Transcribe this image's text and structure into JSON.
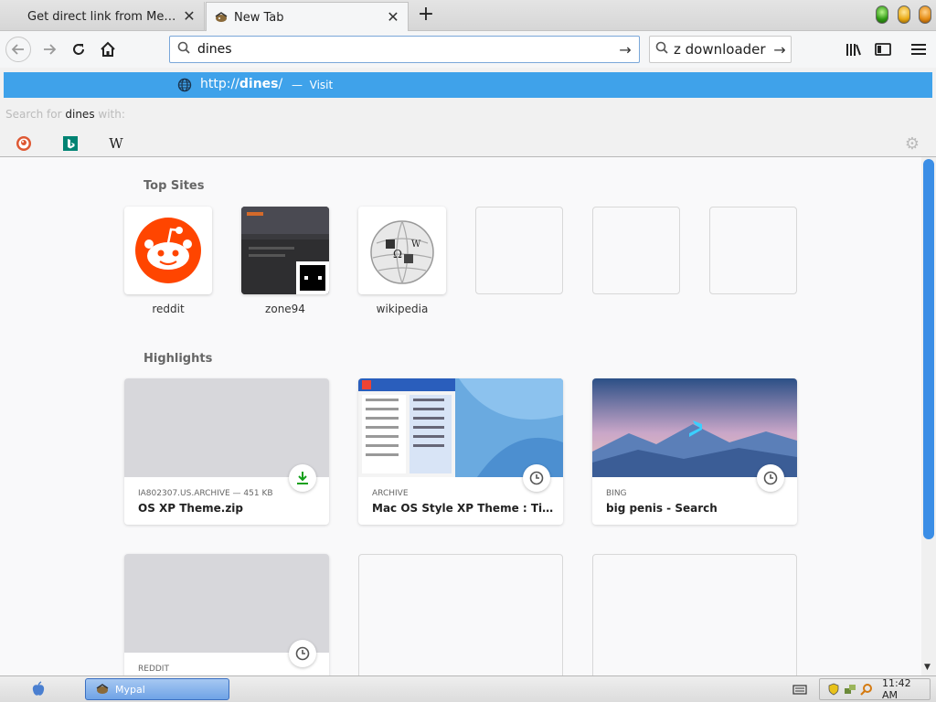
{
  "tabs": [
    {
      "title": "Get direct link from Mega.N…",
      "active": false
    },
    {
      "title": "New Tab",
      "active": true
    }
  ],
  "toolbar": {
    "url_value": "dines",
    "search_value": "z downloader"
  },
  "dropdown": {
    "suggestion": {
      "prefix": "http://",
      "domain": "dines",
      "suffix": "/",
      "separator": "—",
      "action": "Visit"
    },
    "search_for_prefix": "Search for",
    "search_term": "dines",
    "search_for_suffix": "with:",
    "engines": [
      "duckduckgo-icon",
      "bing-icon",
      "wikipedia-icon"
    ],
    "wiki_glyph": "W"
  },
  "newtab": {
    "top_sites_title": "Top Sites",
    "top_sites": [
      {
        "label": "reddit",
        "icon": "reddit-icon"
      },
      {
        "label": "zone94",
        "icon": "zone94-thumbnail"
      },
      {
        "label": "wikipedia",
        "icon": "wikipedia-icon"
      },
      {
        "label": "",
        "empty": true
      },
      {
        "label": "",
        "empty": true
      },
      {
        "label": "",
        "empty": true
      }
    ],
    "highlights_title": "Highlights",
    "highlights": [
      {
        "source": "IA802307.US.ARCHIVE — 451 KB",
        "title": "OS XP Theme.zip",
        "badge": "download-icon"
      },
      {
        "source": "ARCHIVE",
        "title": "Mac OS Style XP Theme : Timdo...",
        "badge": "clock-icon"
      },
      {
        "source": "BING",
        "title": "big penis - Search",
        "badge": "clock-icon"
      },
      {
        "source": "REDDIT",
        "title": "",
        "badge": "clock-icon"
      }
    ]
  },
  "taskbar": {
    "task_label": "Mypal",
    "clock": "11:42 AM"
  },
  "colors": {
    "accent": "#3fa2ea",
    "scroll_thumb": "#3b8ee6",
    "reddit": "#ff4500"
  }
}
